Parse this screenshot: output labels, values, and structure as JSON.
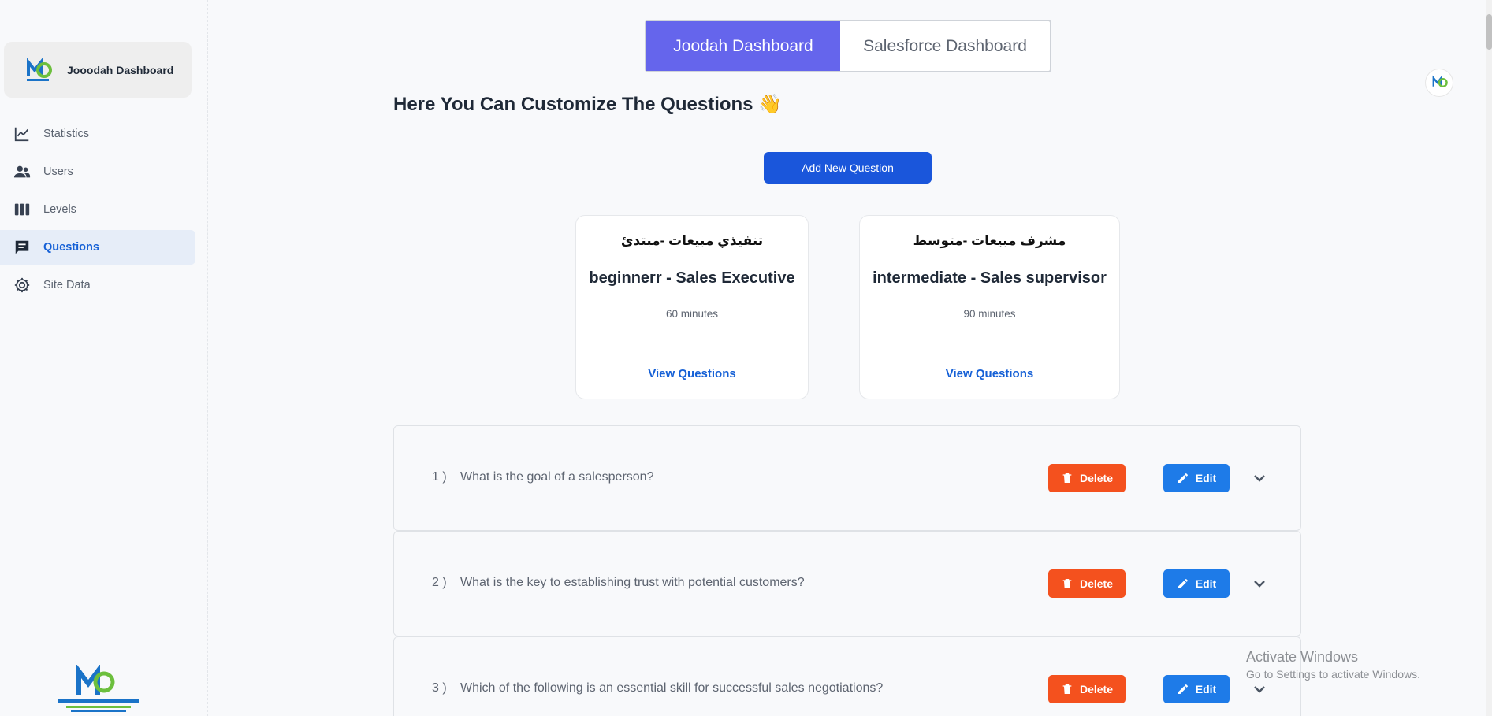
{
  "sidebar": {
    "brand_name": "Jooodah Dashboard",
    "items": [
      {
        "label": "Statistics",
        "icon": "chart-line-icon"
      },
      {
        "label": "Users",
        "icon": "users-icon"
      },
      {
        "label": "Levels",
        "icon": "columns-icon"
      },
      {
        "label": "Questions",
        "icon": "chat-icon",
        "active": true
      },
      {
        "label": "Site Data",
        "icon": "gear-icon"
      }
    ]
  },
  "tabs": [
    {
      "label": "Joodah Dashboard",
      "active": true
    },
    {
      "label": "Salesforce Dashboard",
      "active": false
    }
  ],
  "page": {
    "title": "Here You Can Customize The Questions 👋",
    "add_button": "Add New Question"
  },
  "levels": [
    {
      "title_ar": "تنفيذي مبيعات -مبتدئ",
      "title_en": "beginnerr - Sales Executive",
      "duration": "60 minutes",
      "link": "View Questions"
    },
    {
      "title_ar": "مشرف مبيعات -متوسط",
      "title_en": "intermediate - Sales supervisor",
      "duration": "90 minutes",
      "link": "View Questions"
    }
  ],
  "questions": [
    {
      "num": "1 )",
      "text": "What is the goal of a salesperson?",
      "delete": "Delete",
      "edit": "Edit"
    },
    {
      "num": "2 )",
      "text": "What is the key to establishing trust with potential customers?",
      "delete": "Delete",
      "edit": "Edit"
    },
    {
      "num": "3 )",
      "text": "Which of the following is an essential skill for successful sales negotiations?",
      "delete": "Delete",
      "edit": "Edit"
    }
  ],
  "watermark": {
    "line1": "Activate Windows",
    "line2": "Go to Settings to activate Windows."
  },
  "colors": {
    "accent": "#1a56db",
    "tab_active": "#6565ec",
    "delete": "#f4511e",
    "edit": "#1e7be8"
  }
}
